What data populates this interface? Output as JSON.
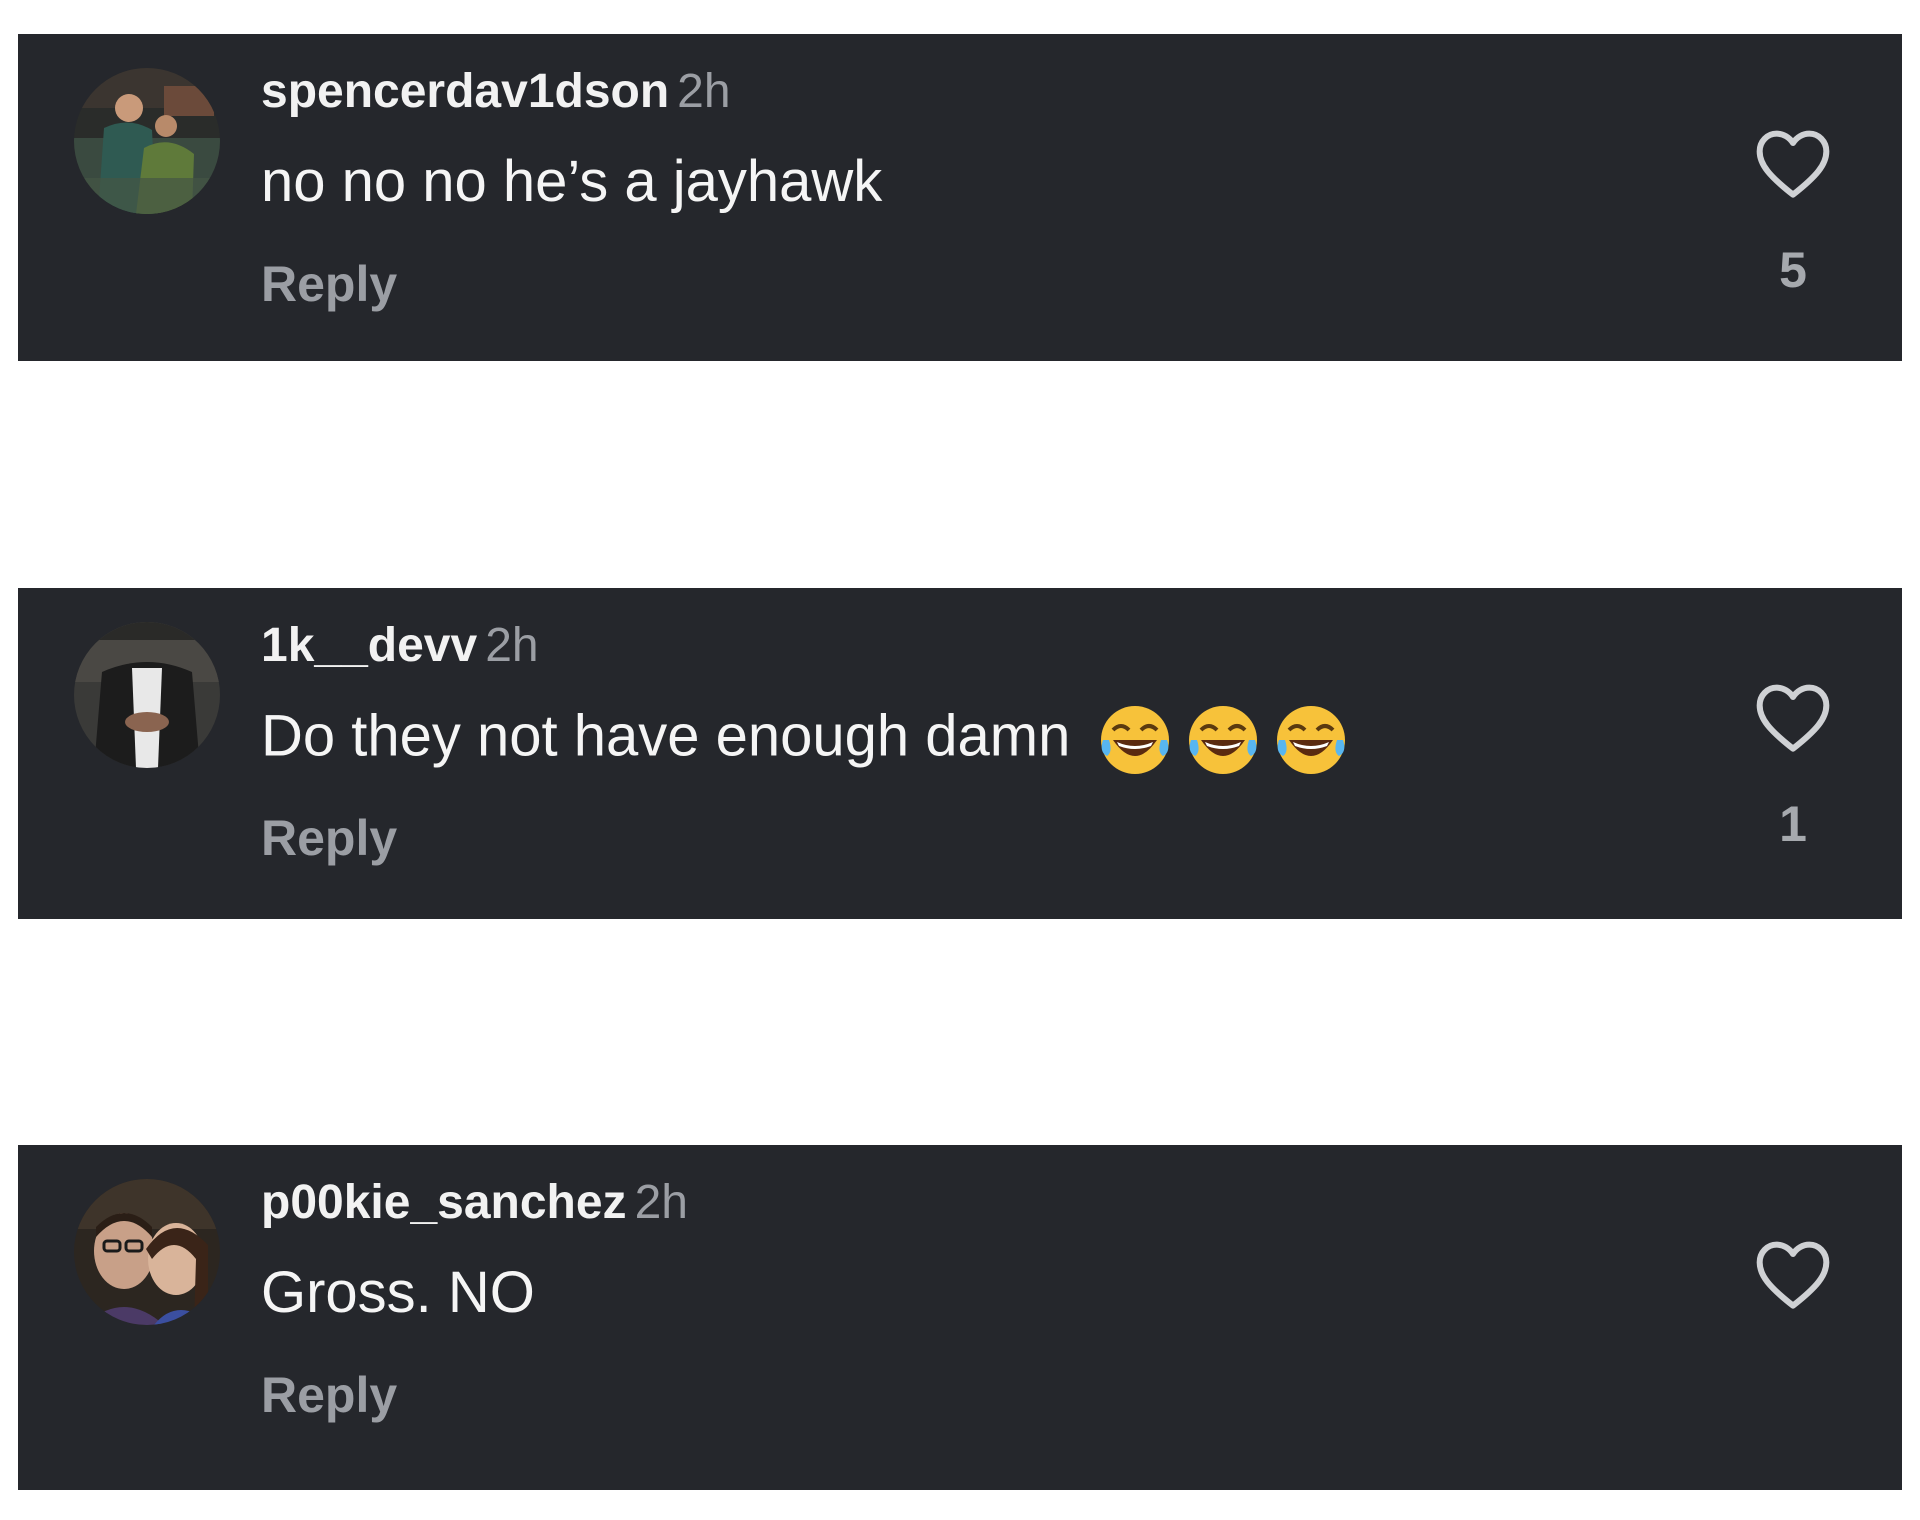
{
  "comments": [
    {
      "username": "spencerdav1dson",
      "timestamp": "2h",
      "text": "no no no he’s a jayhawk",
      "reply_label": "Reply",
      "like_count": "5",
      "avatar_icon": "profile-photo"
    },
    {
      "username": "1k__devv",
      "timestamp": "2h",
      "text": "Do they not have enough damn",
      "emojis": [
        "😂",
        "😂",
        "😂"
      ],
      "reply_label": "Reply",
      "like_count": "1",
      "avatar_icon": "profile-photo"
    },
    {
      "username": "p00kie_sanchez",
      "timestamp": "2h",
      "text": "Gross. NO",
      "reply_label": "Reply",
      "like_count": "",
      "avatar_icon": "profile-photo"
    }
  ],
  "icons": {
    "like": "heart-outline-icon",
    "emoji": "face-with-tears-of-joy"
  },
  "colors": {
    "card_background": "#25272c",
    "page_background": "#ffffff",
    "primary_text": "#f5f5f5",
    "secondary_text": "#9b9ea4"
  }
}
